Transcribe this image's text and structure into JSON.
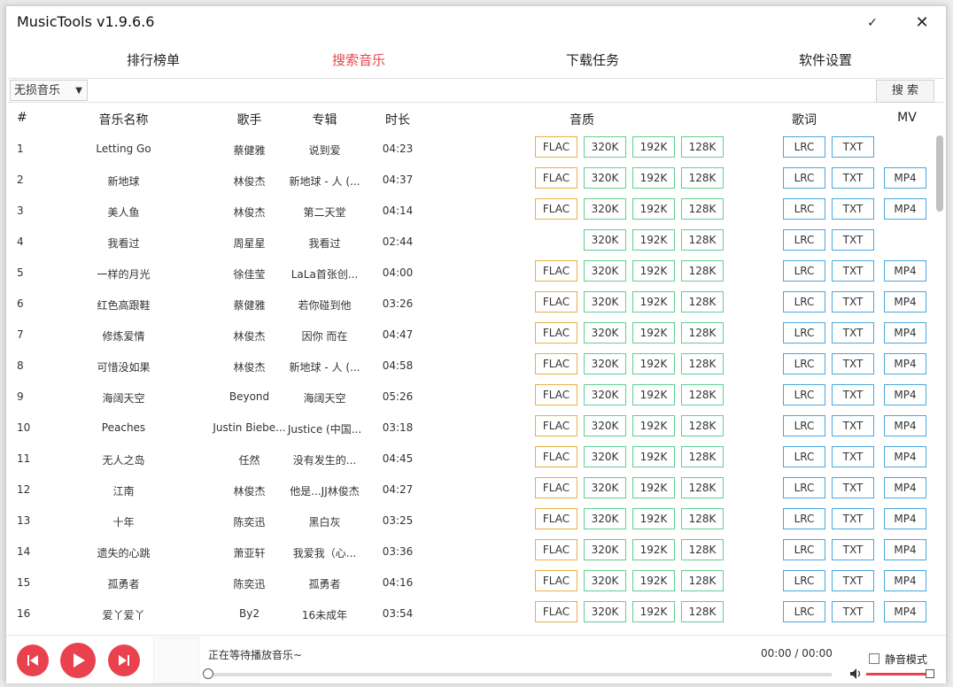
{
  "window": {
    "title": "MusicTools v1.9.6.6",
    "min_glyph": "✓",
    "close_glyph": "✕"
  },
  "tabs": [
    "排行榜单",
    "搜索音乐",
    "下载任务",
    "软件设置"
  ],
  "active_tab": 1,
  "search": {
    "select_value": "无损音乐",
    "input_value": "",
    "button": "搜 索"
  },
  "columns": {
    "index": "#",
    "name": "音乐名称",
    "artist": "歌手",
    "album": "专辑",
    "duration": "时长",
    "quality": "音质",
    "lyrics": "歌词",
    "mv": "MV"
  },
  "songs": [
    {
      "idx": "1",
      "name": "Letting Go",
      "artist": "蔡健雅",
      "album": "说到爱",
      "duration": "04:23",
      "flac": true,
      "mv": false
    },
    {
      "idx": "2",
      "name": "新地球",
      "artist": "林俊杰",
      "album": "新地球 - 人 (...",
      "duration": "04:37",
      "flac": true,
      "mv": true
    },
    {
      "idx": "3",
      "name": "美人鱼",
      "artist": "林俊杰",
      "album": "第二天堂",
      "duration": "04:14",
      "flac": true,
      "mv": true
    },
    {
      "idx": "4",
      "name": "我看过",
      "artist": "周星星",
      "album": "我看过",
      "duration": "02:44",
      "flac": false,
      "mv": false
    },
    {
      "idx": "5",
      "name": "一样的月光",
      "artist": "徐佳莹",
      "album": "LaLa首张创...",
      "duration": "04:00",
      "flac": true,
      "mv": true
    },
    {
      "idx": "6",
      "name": "红色高跟鞋",
      "artist": "蔡健雅",
      "album": "若你碰到他",
      "duration": "03:26",
      "flac": true,
      "mv": true
    },
    {
      "idx": "7",
      "name": "修炼爱情",
      "artist": "林俊杰",
      "album": "因你 而在",
      "duration": "04:47",
      "flac": true,
      "mv": true
    },
    {
      "idx": "8",
      "name": "可惜没如果",
      "artist": "林俊杰",
      "album": "新地球 - 人 (...",
      "duration": "04:58",
      "flac": true,
      "mv": true
    },
    {
      "idx": "9",
      "name": "海阔天空",
      "artist": "Beyond",
      "album": "海阔天空",
      "duration": "05:26",
      "flac": true,
      "mv": true
    },
    {
      "idx": "10",
      "name": "Peaches",
      "artist": "Justin Biebe...",
      "album": "Justice (中国...",
      "duration": "03:18",
      "flac": true,
      "mv": true
    },
    {
      "idx": "11",
      "name": "无人之岛",
      "artist": "任然",
      "album": "没有发生的...",
      "duration": "04:45",
      "flac": true,
      "mv": true
    },
    {
      "idx": "12",
      "name": "江南",
      "artist": "林俊杰",
      "album": "他是...JJ林俊杰",
      "duration": "04:27",
      "flac": true,
      "mv": true
    },
    {
      "idx": "13",
      "name": "十年",
      "artist": "陈奕迅",
      "album": "黑白灰",
      "duration": "03:25",
      "flac": true,
      "mv": true
    },
    {
      "idx": "14",
      "name": "遗失的心跳",
      "artist": "萧亚轩",
      "album": "我爱我（心...",
      "duration": "03:36",
      "flac": true,
      "mv": true
    },
    {
      "idx": "15",
      "name": "孤勇者",
      "artist": "陈奕迅",
      "album": "孤勇者",
      "duration": "04:16",
      "flac": true,
      "mv": true
    },
    {
      "idx": "16",
      "name": "爱丫爱丫",
      "artist": "By2",
      "album": "16未成年",
      "duration": "03:54",
      "flac": true,
      "mv": true
    }
  ],
  "buttons": {
    "flac": "FLAC",
    "q320": "320K",
    "q192": "192K",
    "q128": "128K",
    "lrc": "LRC",
    "txt": "TXT",
    "mp4": "MP4"
  },
  "player": {
    "status": "正在等待播放音乐~",
    "time": "00:00 / 00:00",
    "mute_label": "静音模式",
    "progress": 0,
    "volume": 1.0
  },
  "colors": {
    "accent": "#e9414d",
    "flac_border": "#e8b042",
    "quality_border": "#5fcf91",
    "lyric_border": "#48a7dc"
  }
}
